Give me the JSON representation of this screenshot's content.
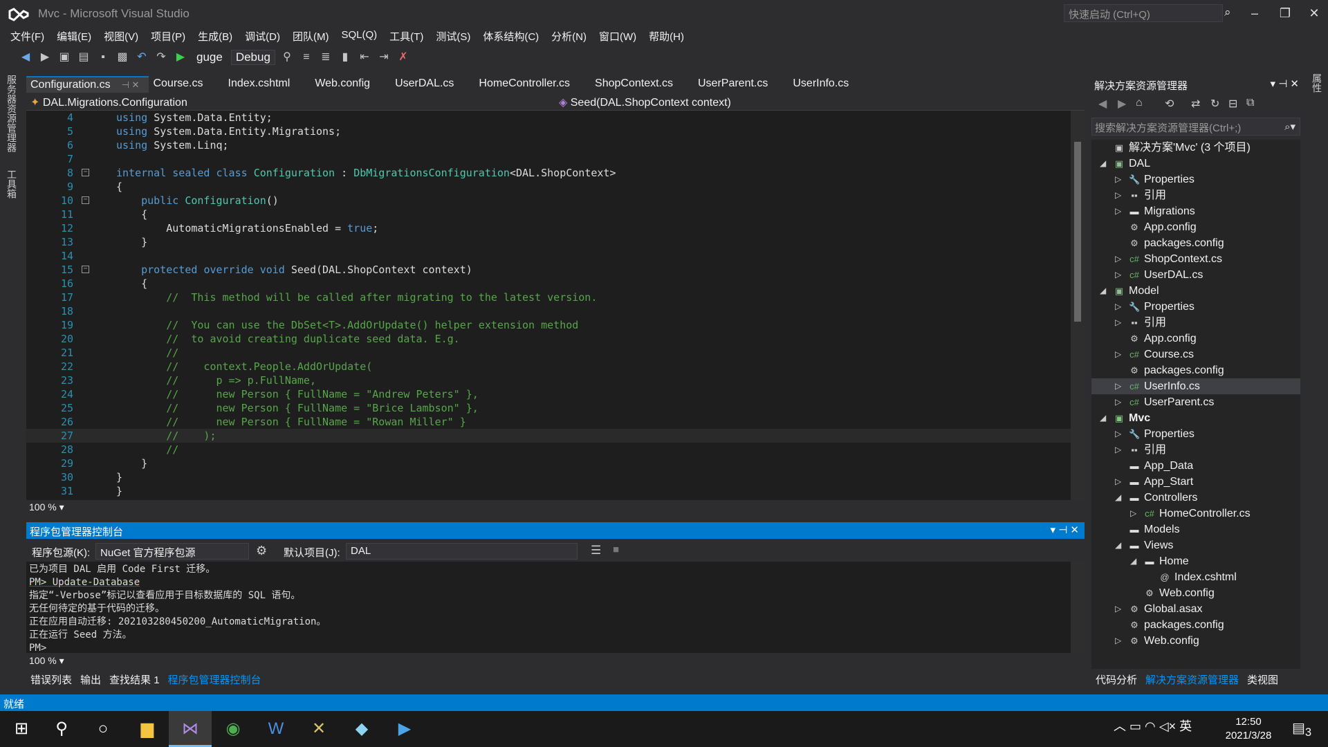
{
  "window": {
    "title": "Mvc - Microsoft Visual Studio",
    "quick_launch_placeholder": "快速启动 (Ctrl+Q)"
  },
  "menu": [
    "文件(F)",
    "编辑(E)",
    "视图(V)",
    "项目(P)",
    "生成(B)",
    "调试(D)",
    "团队(M)",
    "SQL(Q)",
    "工具(T)",
    "测试(S)",
    "体系结构(C)",
    "分析(N)",
    "窗口(W)",
    "帮助(H)"
  ],
  "toolbar": {
    "start_target": "guge",
    "configuration": "Debug"
  },
  "left_strip": [
    "服务器资源管理器",
    "工具箱"
  ],
  "right_strip": [
    "属性"
  ],
  "editor_tabs": [
    "Configuration.cs",
    "Course.cs",
    "Index.cshtml",
    "Web.config",
    "UserDAL.cs",
    "HomeController.cs",
    "ShopContext.cs",
    "UserParent.cs",
    "UserInfo.cs"
  ],
  "navbar": {
    "type": "DAL.Migrations.Configuration",
    "member": "Seed(DAL.ShopContext context)"
  },
  "code": [
    {
      "n": "4",
      "t": "using System.Data.Entity;"
    },
    {
      "n": "5",
      "t": "using System.Data.Entity.Migrations;"
    },
    {
      "n": "6",
      "t": "using System.Linq;"
    },
    {
      "n": "7",
      "t": ""
    },
    {
      "n": "8",
      "t": "internal sealed class Configuration : DbMigrationsConfiguration<DAL.ShopContext>"
    },
    {
      "n": "9",
      "t": "{"
    },
    {
      "n": "10",
      "t": "    public Configuration()"
    },
    {
      "n": "11",
      "t": "    {"
    },
    {
      "n": "12",
      "t": "        AutomaticMigrationsEnabled = true;"
    },
    {
      "n": "13",
      "t": "    }"
    },
    {
      "n": "14",
      "t": ""
    },
    {
      "n": "15",
      "t": "    protected override void Seed(DAL.ShopContext context)"
    },
    {
      "n": "16",
      "t": "    {"
    },
    {
      "n": "17",
      "t": "        //  This method will be called after migrating to the latest version."
    },
    {
      "n": "18",
      "t": ""
    },
    {
      "n": "19",
      "t": "        //  You can use the DbSet<T>.AddOrUpdate() helper extension method"
    },
    {
      "n": "20",
      "t": "        //  to avoid creating duplicate seed data. E.g."
    },
    {
      "n": "21",
      "t": "        //"
    },
    {
      "n": "22",
      "t": "        //    context.People.AddOrUpdate("
    },
    {
      "n": "23",
      "t": "        //      p => p.FullName,"
    },
    {
      "n": "24",
      "t": "        //      new Person { FullName = \"Andrew Peters\" },"
    },
    {
      "n": "25",
      "t": "        //      new Person { FullName = \"Brice Lambson\" },"
    },
    {
      "n": "26",
      "t": "        //      new Person { FullName = \"Rowan Miller\" }"
    },
    {
      "n": "27",
      "t": "        //    );"
    },
    {
      "n": "28",
      "t": "        //"
    },
    {
      "n": "29",
      "t": "    }"
    },
    {
      "n": "30",
      "t": "}"
    },
    {
      "n": "31",
      "t": "}"
    }
  ],
  "zoom": "100 %",
  "pmc": {
    "title": "程序包管理器控制台",
    "source_label": "程序包源(K):",
    "source_value": "NuGet 官方程序包源",
    "project_label": "默认项目(J):",
    "project_value": "DAL",
    "output": [
      "已为项目 DAL 启用 Code First 迁移。",
      "PM> Update-Database",
      "指定“-Verbose”标记以查看应用于目标数据库的 SQL 语句。",
      "无任何待定的基于代码的迁移。",
      "正在应用自动迁移: 202103280450200_AutomaticMigration。",
      "正在运行 Seed 方法。",
      "PM>"
    ]
  },
  "bottom_tabs": [
    "错误列表",
    "输出",
    "查找结果 1",
    "程序包管理器控制台"
  ],
  "solution_explorer": {
    "title": "解决方案资源管理器",
    "search_placeholder": "搜索解决方案资源管理器(Ctrl+;)",
    "tree": [
      {
        "label": "解决方案'Mvc' (3 个项目)",
        "depth": 0,
        "arrow": "",
        "icon": "solution-icon"
      },
      {
        "label": "DAL",
        "depth": 0,
        "arrow": "open",
        "icon": "project-icon"
      },
      {
        "label": "Properties",
        "depth": 1,
        "arrow": "closed",
        "icon": "wrench-icon"
      },
      {
        "label": "引用",
        "depth": 1,
        "arrow": "closed",
        "icon": "references-icon"
      },
      {
        "label": "Migrations",
        "depth": 1,
        "arrow": "closed",
        "icon": "folder-icon"
      },
      {
        "label": "App.config",
        "depth": 1,
        "arrow": "",
        "icon": "config-icon"
      },
      {
        "label": "packages.config",
        "depth": 1,
        "arrow": "",
        "icon": "config-icon"
      },
      {
        "label": "ShopContext.cs",
        "depth": 1,
        "arrow": "closed",
        "icon": "csharp-icon"
      },
      {
        "label": "UserDAL.cs",
        "depth": 1,
        "arrow": "closed",
        "icon": "csharp-icon"
      },
      {
        "label": "Model",
        "depth": 0,
        "arrow": "open",
        "icon": "project-icon"
      },
      {
        "label": "Properties",
        "depth": 1,
        "arrow": "closed",
        "icon": "wrench-icon"
      },
      {
        "label": "引用",
        "depth": 1,
        "arrow": "closed",
        "icon": "references-icon"
      },
      {
        "label": "App.config",
        "depth": 1,
        "arrow": "",
        "icon": "config-icon"
      },
      {
        "label": "Course.cs",
        "depth": 1,
        "arrow": "closed",
        "icon": "csharp-icon"
      },
      {
        "label": "packages.config",
        "depth": 1,
        "arrow": "",
        "icon": "config-icon"
      },
      {
        "label": "UserInfo.cs",
        "depth": 1,
        "arrow": "closed",
        "icon": "csharp-icon",
        "selected": true
      },
      {
        "label": "UserParent.cs",
        "depth": 1,
        "arrow": "closed",
        "icon": "csharp-icon"
      },
      {
        "label": "Mvc",
        "depth": 0,
        "arrow": "open",
        "icon": "web-project-icon",
        "bold": true
      },
      {
        "label": "Properties",
        "depth": 1,
        "arrow": "closed",
        "icon": "wrench-icon"
      },
      {
        "label": "引用",
        "depth": 1,
        "arrow": "closed",
        "icon": "references-icon"
      },
      {
        "label": "App_Data",
        "depth": 1,
        "arrow": "",
        "icon": "folder-icon"
      },
      {
        "label": "App_Start",
        "depth": 1,
        "arrow": "closed",
        "icon": "folder-icon"
      },
      {
        "label": "Controllers",
        "depth": 1,
        "arrow": "open",
        "icon": "folder-icon"
      },
      {
        "label": "HomeController.cs",
        "depth": 2,
        "arrow": "closed",
        "icon": "csharp-icon"
      },
      {
        "label": "Models",
        "depth": 1,
        "arrow": "",
        "icon": "folder-icon"
      },
      {
        "label": "Views",
        "depth": 1,
        "arrow": "open",
        "icon": "folder-icon"
      },
      {
        "label": "Home",
        "depth": 2,
        "arrow": "open",
        "icon": "folder-icon"
      },
      {
        "label": "Index.cshtml",
        "depth": 3,
        "arrow": "",
        "icon": "razor-icon"
      },
      {
        "label": "Web.config",
        "depth": 2,
        "arrow": "",
        "icon": "config-icon"
      },
      {
        "label": "Global.asax",
        "depth": 1,
        "arrow": "closed",
        "icon": "config-icon"
      },
      {
        "label": "packages.config",
        "depth": 1,
        "arrow": "",
        "icon": "config-icon"
      },
      {
        "label": "Web.config",
        "depth": 1,
        "arrow": "closed",
        "icon": "config-icon"
      }
    ]
  },
  "se_tabs": [
    "代码分析",
    "解决方案资源管理器",
    "类视图"
  ],
  "status": "就绪",
  "taskbar": {
    "time": "12:50",
    "date": "2021/3/28",
    "ime": "英",
    "notifications": "3"
  }
}
